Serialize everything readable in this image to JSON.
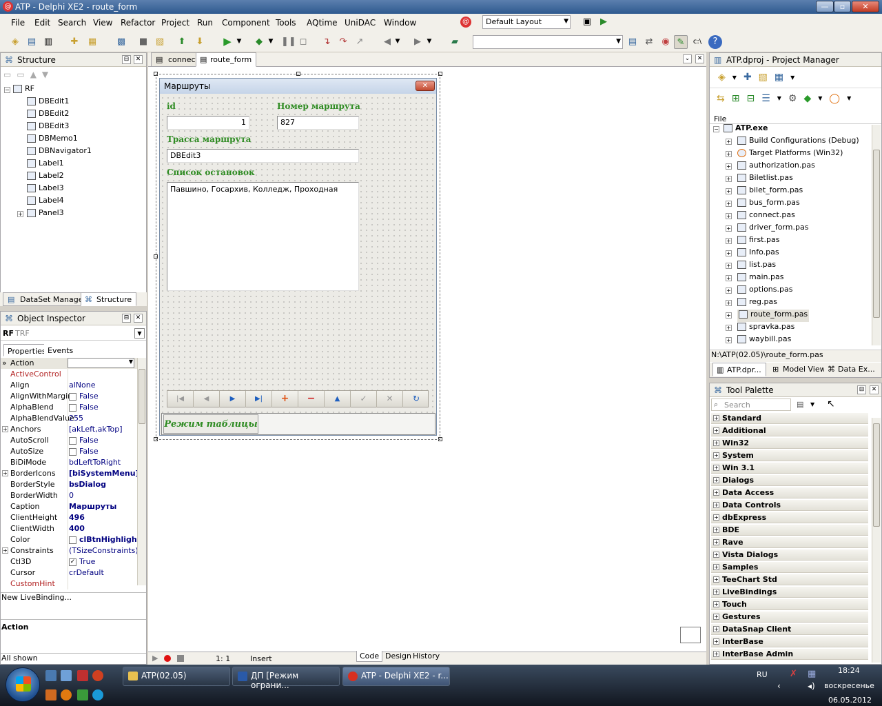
{
  "window": {
    "title": "ATP - Delphi XE2 - route_form",
    "min": "—",
    "max": "▫",
    "close": "✕"
  },
  "menu": [
    "File",
    "Edit",
    "Search",
    "View",
    "Refactor",
    "Project",
    "Run",
    "Component",
    "Tools",
    "AQtime",
    "UniDAC",
    "Window"
  ],
  "toolbar": {
    "layout_combo": "Default Layout",
    "second_combo": ""
  },
  "structure": {
    "title": "Structure",
    "root": "RF",
    "items": [
      "DBEdit1",
      "DBEdit2",
      "DBEdit3",
      "DBMemo1",
      "DBNavigator1",
      "Label1",
      "Label2",
      "Label3",
      "Label4",
      "Panel3"
    ],
    "tabs": [
      "DataSet Manager",
      "Structure"
    ]
  },
  "object_inspector": {
    "title": "Object Inspector",
    "selected_name": "RF",
    "selected_type": "TRF",
    "tabs": [
      "Properties",
      "Events"
    ],
    "header_prop": "Action",
    "rows": [
      {
        "name": "ActiveControl",
        "value": "",
        "red": true
      },
      {
        "name": "Align",
        "value": "alNone"
      },
      {
        "name": "AlignWithMargins",
        "value": "False",
        "check": ""
      },
      {
        "name": "AlphaBlend",
        "value": "False",
        "check": ""
      },
      {
        "name": "AlphaBlendValue",
        "value": "255"
      },
      {
        "name": "Anchors",
        "value": "[akLeft,akTop]",
        "plus": true
      },
      {
        "name": "AutoScroll",
        "value": "False",
        "check": ""
      },
      {
        "name": "AutoSize",
        "value": "False",
        "check": ""
      },
      {
        "name": "BiDiMode",
        "value": "bdLeftToRight"
      },
      {
        "name": "BorderIcons",
        "value": "[biSystemMenu]",
        "bold": true,
        "plus": true
      },
      {
        "name": "BorderStyle",
        "value": "bsDialog",
        "bold": true
      },
      {
        "name": "BorderWidth",
        "value": "0"
      },
      {
        "name": "Caption",
        "value": "Маршруты",
        "bold": true
      },
      {
        "name": "ClientHeight",
        "value": "496",
        "bold": true
      },
      {
        "name": "ClientWidth",
        "value": "400",
        "bold": true
      },
      {
        "name": "Color",
        "value": "clBtnHighlight",
        "bold": true,
        "check": ""
      },
      {
        "name": "Constraints",
        "value": "(TSizeConstraints)",
        "plus": true
      },
      {
        "name": "Ctl3D",
        "value": "True",
        "check": "✓"
      },
      {
        "name": "Cursor",
        "value": "crDefault"
      },
      {
        "name": "CustomHint",
        "value": "",
        "red": true
      }
    ],
    "live_binding": "New LiveBinding...",
    "desc_title": "Action",
    "status": "All shown"
  },
  "editor_tabs": [
    "connect",
    "route_form"
  ],
  "form": {
    "caption": "Маршруты",
    "label_id": "id",
    "label_number": "Номер маршрута",
    "value_id": "1",
    "value_number": "827",
    "label_track": "Трасса маршрута",
    "value_track": "DBEdit3",
    "label_stops": "Список остановок",
    "value_stops": "Павшино, Госархив, Колледж, Проходная",
    "navigator": [
      "|◀",
      "◀",
      "▶",
      "▶|",
      "+",
      "−",
      "▲",
      "✓",
      "✕",
      "↻"
    ],
    "mode_button": "Режим таблицы"
  },
  "statusbar": {
    "position": "1:  1",
    "mode": "Insert",
    "tabs": [
      "Code",
      "Design",
      "History"
    ]
  },
  "project_manager": {
    "title": "ATP.dproj - Project Manager",
    "col": "File",
    "root": "ATP.exe",
    "items": [
      "Build Configurations (Debug)",
      "Target Platforms (Win32)",
      "authorization.pas",
      "Biletlist.pas",
      "bilet_form.pas",
      "bus_form.pas",
      "connect.pas",
      "driver_form.pas",
      "first.pas",
      "Info.pas",
      "list.pas",
      "main.pas",
      "options.pas",
      "reg.pas",
      "route_form.pas",
      "spravka.pas",
      "waybill.pas"
    ],
    "path": "N:\\ATP(02.05)\\route_form.pas",
    "tabs": [
      "ATP.dpr...",
      "Model View",
      "Data Ex..."
    ]
  },
  "tool_palette": {
    "title": "Tool Palette",
    "search_placeholder": "Search",
    "groups": [
      "Standard",
      "Additional",
      "Win32",
      "System",
      "Win 3.1",
      "Dialogs",
      "Data Access",
      "Data Controls",
      "dbExpress",
      "BDE",
      "Rave",
      "Vista Dialogs",
      "Samples",
      "TeeChart Std",
      "LiveBindings",
      "Touch",
      "Gestures",
      "DataSnap Client",
      "InterBase",
      "InterBase Admin"
    ]
  },
  "taskbar": {
    "tasks": [
      "ATP(02.05)",
      "ДП [Режим ограни...",
      "ATP - Delphi XE2 - r..."
    ],
    "lang": "RU",
    "time": "18:24",
    "day": "воскресенье",
    "date": "06.05.2012"
  },
  "colors": {
    "label_green": "#2e8b22",
    "title_blue": "#2f5a8f",
    "taskbar": "#1f2a38"
  }
}
